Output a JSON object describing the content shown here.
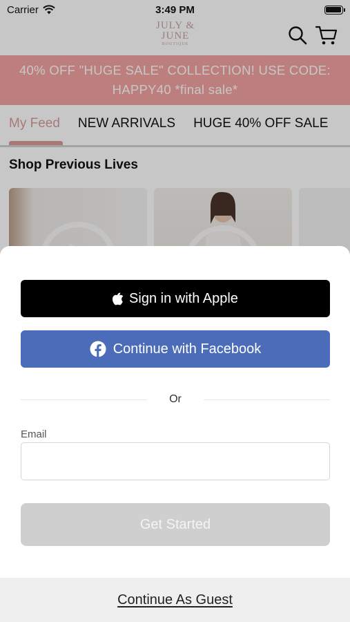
{
  "status_bar": {
    "carrier": "Carrier",
    "time": "3:49 PM"
  },
  "header": {
    "logo_line1": "JULY &",
    "logo_line2": "JUNE",
    "logo_sub": "BOUTIQUE"
  },
  "promo": {
    "line1": "40% OFF \"HUGE SALE\" COLLECTION! USE CODE:",
    "line2": "HAPPY40 *final sale*"
  },
  "tabs": [
    {
      "label": "My Feed",
      "active": true
    },
    {
      "label": "NEW ARRIVALS",
      "active": false
    },
    {
      "label": "HUGE 40% OFF SALE",
      "active": false
    }
  ],
  "section": {
    "title": "Shop Previous Lives"
  },
  "sheet": {
    "apple_label": "Sign in with Apple",
    "facebook_label": "Continue with Facebook",
    "or_label": "Or",
    "email_label": "Email",
    "email_value": "",
    "email_placeholder": "",
    "get_started_label": "Get Started",
    "guest_label": "Continue As Guest"
  },
  "colors": {
    "promo_bg": "#f2a3a0",
    "tab_accent": "#d79c99",
    "facebook_blue": "#4a6cb9",
    "apple_black": "#000000",
    "disabled_button": "#cfcfcf"
  },
  "icons": [
    "wifi-icon",
    "battery-icon",
    "search-icon",
    "cart-icon",
    "apple-icon",
    "facebook-icon"
  ]
}
